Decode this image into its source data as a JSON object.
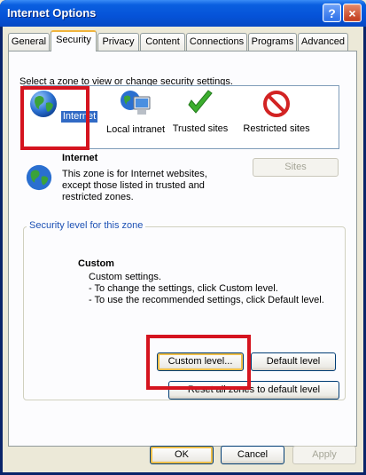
{
  "window": {
    "title": "Internet Options",
    "help": "?",
    "close": "×"
  },
  "tabs": [
    "General",
    "Security",
    "Privacy",
    "Content",
    "Connections",
    "Programs",
    "Advanced"
  ],
  "active_tab": "Security",
  "zone_prompt": "Select a zone to view or change security settings.",
  "zones": [
    {
      "label": "Internet",
      "icon": "globe-icon",
      "selected": true
    },
    {
      "label": "Local intranet",
      "icon": "local-intranet-icon",
      "selected": false
    },
    {
      "label": "Trusted sites",
      "icon": "checkmark-icon",
      "selected": false
    },
    {
      "label": "Restricted sites",
      "icon": "restricted-icon",
      "selected": false
    }
  ],
  "zone_info": {
    "title": "Internet",
    "description": "This zone is for Internet websites, except those listed in trusted and restricted zones.",
    "sites_button": "Sites"
  },
  "security_level": {
    "group_title": "Security level for this zone",
    "level_name": "Custom",
    "lines": [
      "Custom settings.",
      "- To change the settings, click Custom level.",
      "- To use the recommended settings, click Default level."
    ],
    "custom_button": "Custom level...",
    "default_button": "Default level",
    "reset_button": "Reset all zones to default level"
  },
  "footer": {
    "ok": "OK",
    "cancel": "Cancel",
    "apply": "Apply"
  },
  "colors": {
    "highlight": "#d5141f",
    "selection": "#316ac5",
    "titlebar": "#0553d8"
  }
}
